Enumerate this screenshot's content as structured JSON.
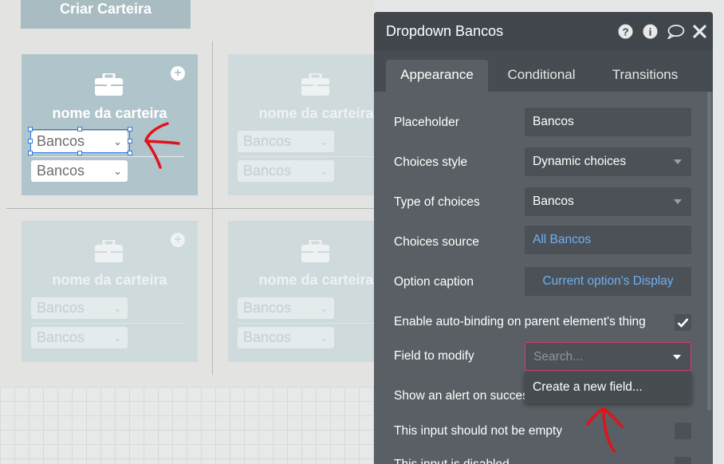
{
  "canvas": {
    "top_button": "Criar Carteira",
    "cards": [
      {
        "title": "nome da carteira",
        "dropdown1": "Bancos",
        "dropdown2": "Bancos"
      },
      {
        "title": "nome da carteira",
        "dropdown1": "Bancos",
        "dropdown2": "Bancos"
      },
      {
        "title": "nome da carteira",
        "dropdown1": "Bancos",
        "dropdown2": "Bancos"
      },
      {
        "title": "nome da carteira",
        "dropdown1": "Bancos",
        "dropdown2": "Bancos"
      }
    ]
  },
  "panel": {
    "title": "Dropdown Bancos",
    "tabs": [
      "Appearance",
      "Conditional",
      "Transitions"
    ],
    "rows": {
      "placeholder_label": "Placeholder",
      "placeholder_value": "Bancos",
      "choices_style_label": "Choices style",
      "choices_style_value": "Dynamic choices",
      "type_of_choices_label": "Type of choices",
      "type_of_choices_value": "Bancos",
      "choices_source_label": "Choices source",
      "choices_source_value": "All Bancos",
      "option_caption_label": "Option caption",
      "option_caption_value": "Current option's Display",
      "auto_binding_label": "Enable auto-binding on parent element's thing",
      "field_to_modify_label": "Field to modify",
      "field_to_modify_placeholder": "Search...",
      "show_alert_label": "Show an alert on success",
      "not_empty_label": "This input should not be empty",
      "disabled_label": "This input is disabled"
    },
    "popup_item": "Create a new field...",
    "auto_binding_checked": true
  },
  "colors": {
    "annotation": "#e0131c",
    "link": "#6fb1f5",
    "error_border": "#d83b6b"
  }
}
